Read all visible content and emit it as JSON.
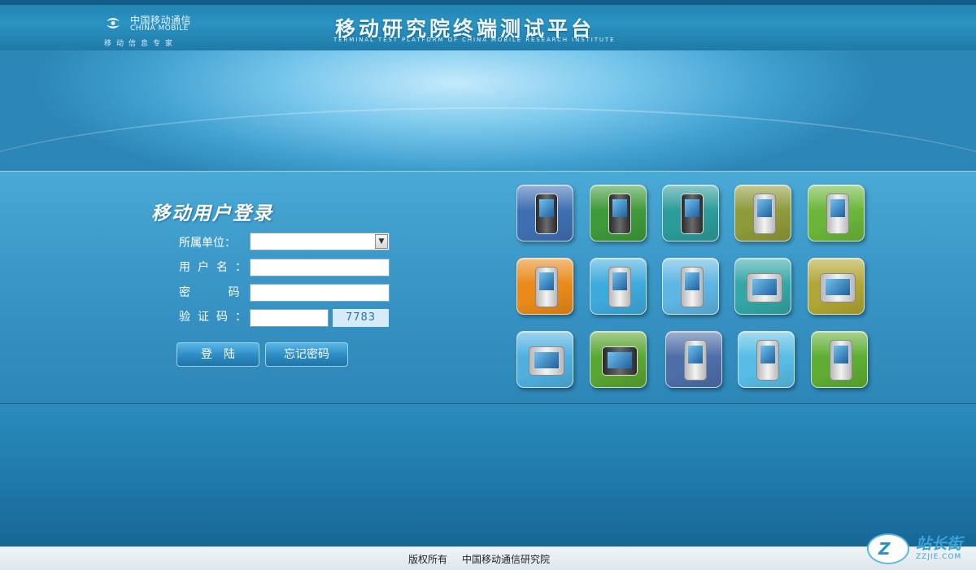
{
  "header": {
    "logo_cn": "中国移动通信",
    "logo_en": "CHINA MOBILE",
    "logo_slogan": "移动信息专家",
    "title": "移动研究院终端测试平台",
    "subtitle": "TERMINAL TEST PLATFORM OF CHINA MOBILE RESEARCH INSTITUTE"
  },
  "login": {
    "title": "移动用户登录",
    "unit_label": "所属单位：",
    "unit_selected": "",
    "username_label": "用户名：",
    "username_value": "",
    "password_label": "密 码：",
    "password_value": "",
    "captcha_label": "验证码：",
    "captcha_value": "",
    "captcha_code": "7783",
    "login_button": "登陆",
    "forgot_button": "忘记密码"
  },
  "devices": [
    {
      "name": "device-pda-blue",
      "color": "#3f6fb2"
    },
    {
      "name": "device-phone-green",
      "color": "#3f9a3a"
    },
    {
      "name": "device-phone-teal",
      "color": "#2c9c9a"
    },
    {
      "name": "device-phone-olive",
      "color": "#8f9a3a"
    },
    {
      "name": "device-phone-lime",
      "color": "#6bb63a"
    },
    {
      "name": "device-phone-orange",
      "color": "#e98a1a"
    },
    {
      "name": "device-phone-cyan",
      "color": "#3eaadc"
    },
    {
      "name": "device-reader-sky",
      "color": "#5fb5e3"
    },
    {
      "name": "device-deskphone-teal",
      "color": "#34a6a6"
    },
    {
      "name": "device-card-olive",
      "color": "#b2a634"
    },
    {
      "name": "device-monitor-sky",
      "color": "#4fb0e0"
    },
    {
      "name": "device-slider-green",
      "color": "#5aa632"
    },
    {
      "name": "device-pda-navy",
      "color": "#4d6ea8"
    },
    {
      "name": "device-phone-aqua",
      "color": "#58bde6"
    },
    {
      "name": "device-phone-green2",
      "color": "#5fae33"
    }
  ],
  "footer": {
    "copyright": "版权所有",
    "org": "中国移动通信研究院"
  },
  "watermark": {
    "cn": "站长街",
    "en": "ZZJIE.COM",
    "mark": "Z"
  }
}
